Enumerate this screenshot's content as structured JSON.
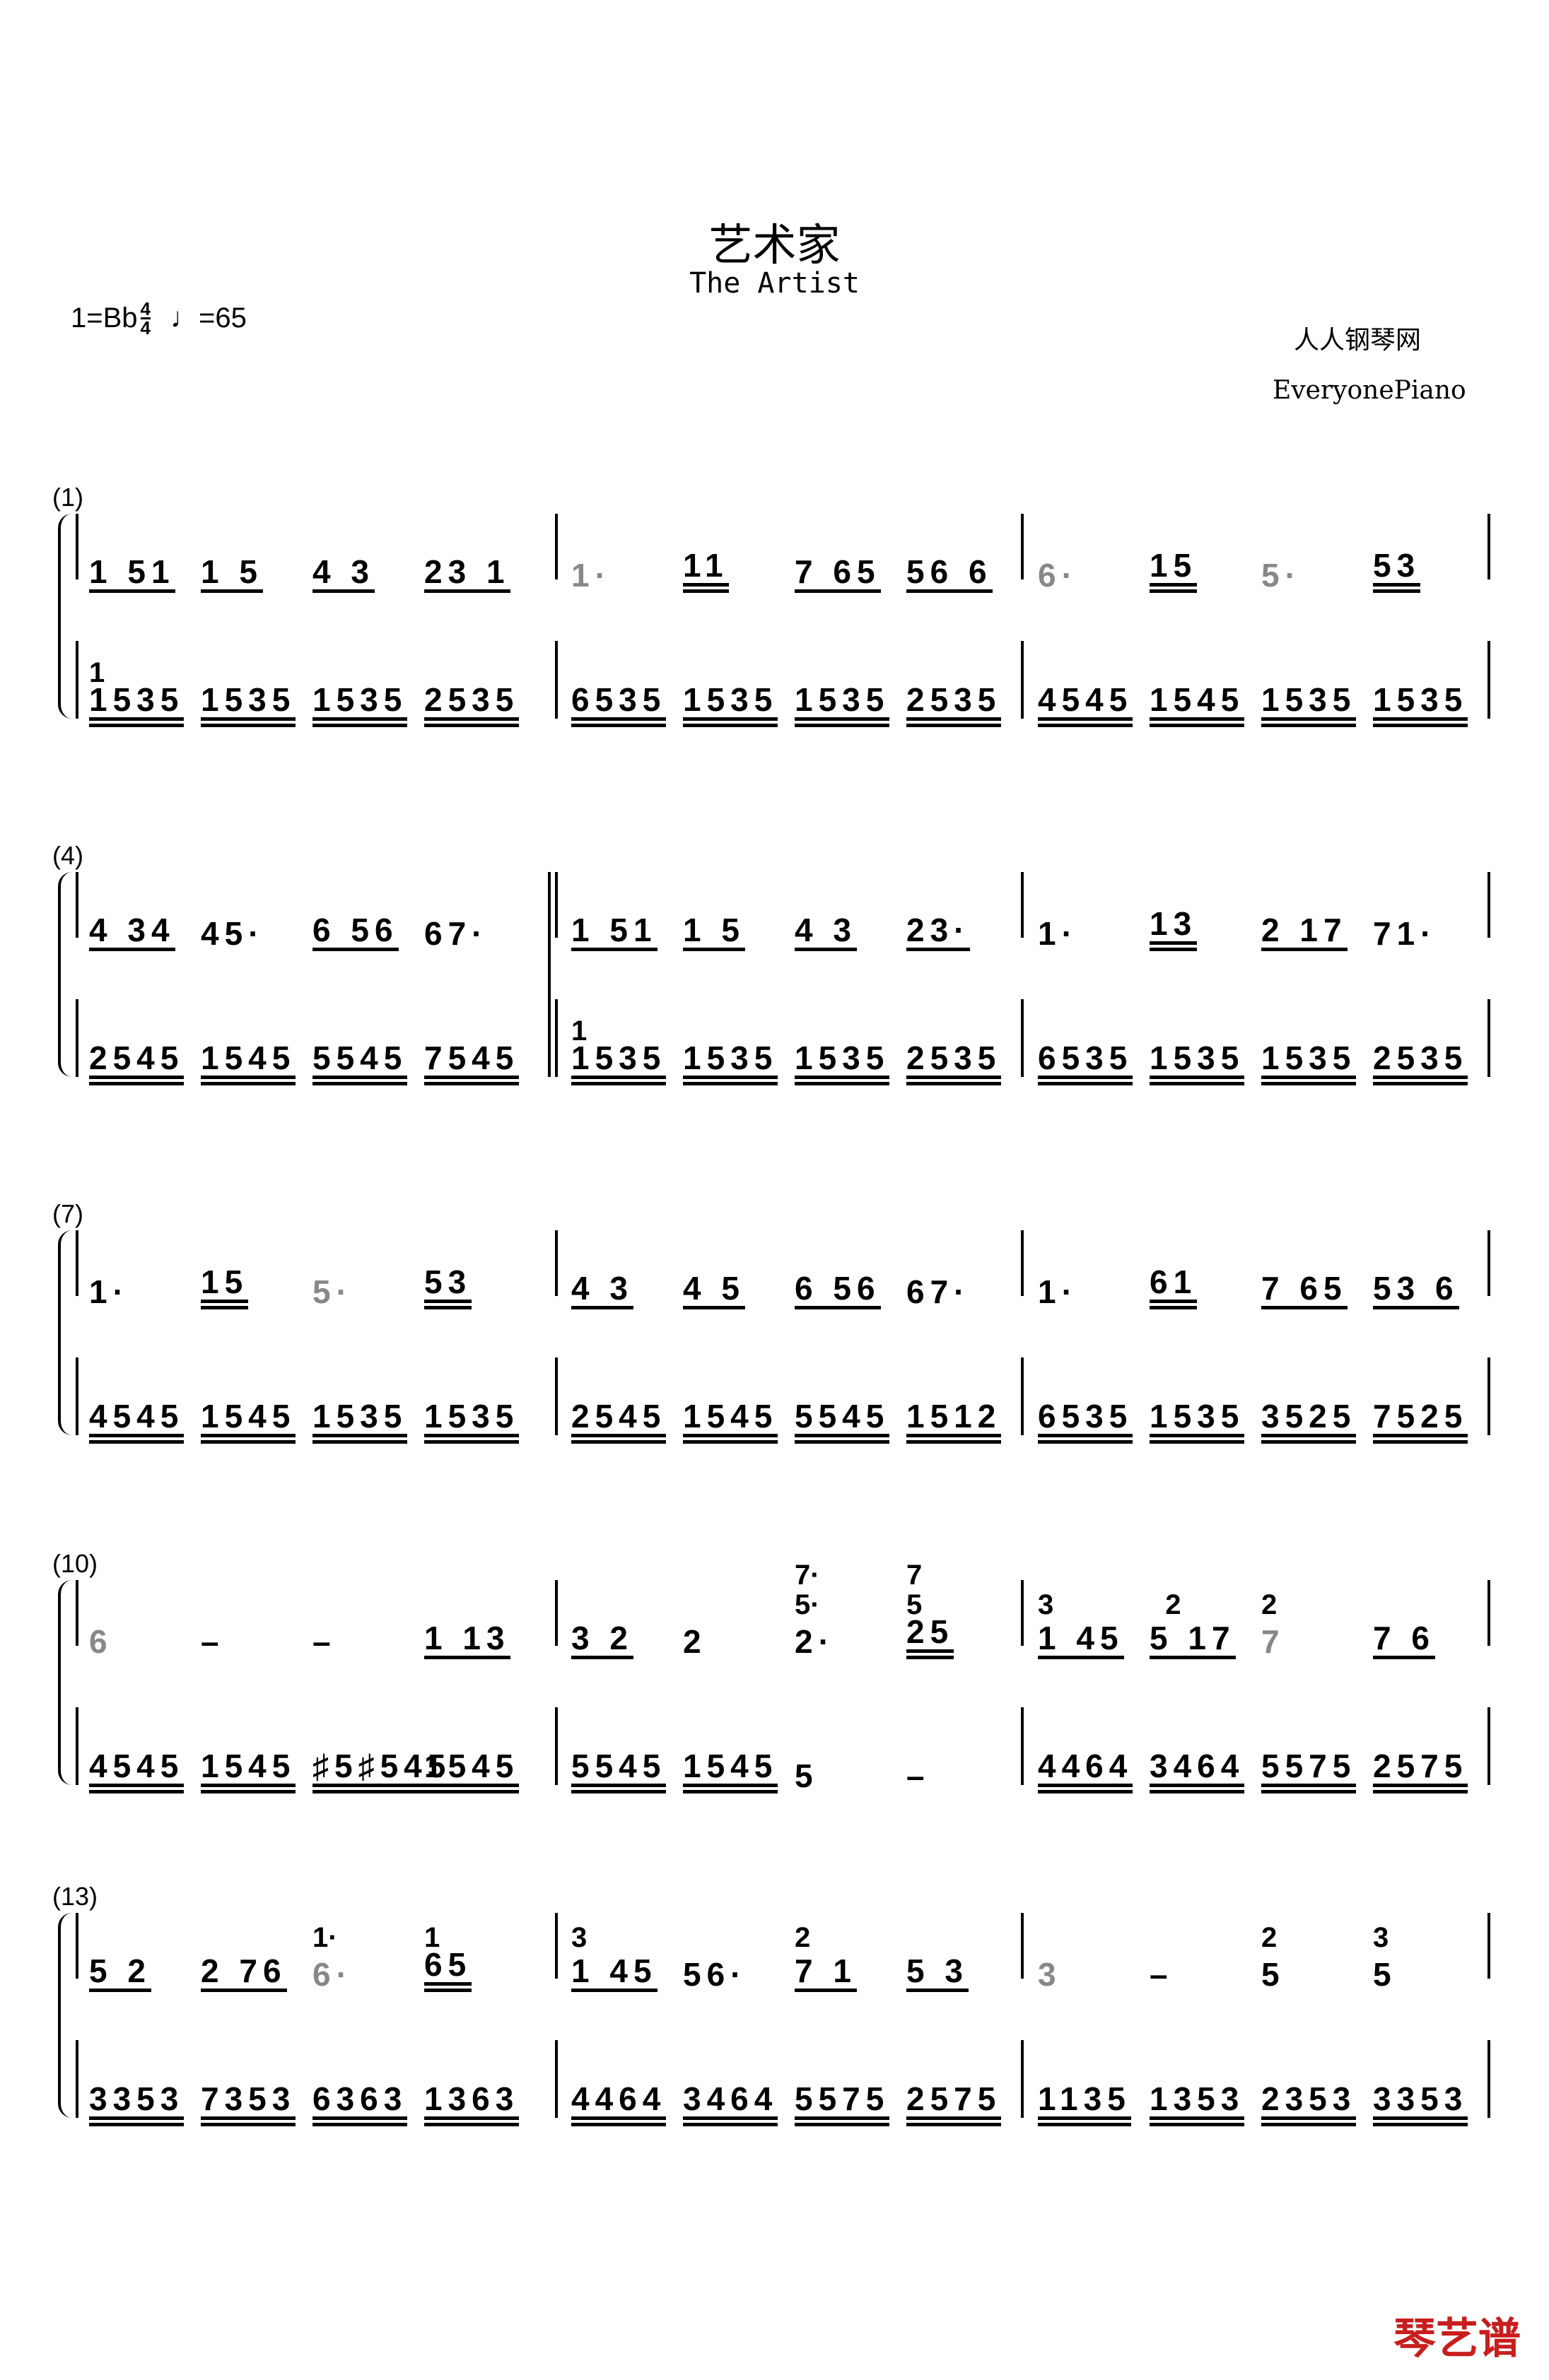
{
  "header": {
    "title": "艺术家",
    "subtitle": "The Artist",
    "key": "1=Bb",
    "time_top": "4",
    "time_bottom": "4",
    "tempo": "♩=65",
    "credit_cn": "人人钢琴网",
    "credit_en": "EveryonePiano"
  },
  "logo": "琴艺谱",
  "logo_color": "#c81e1e",
  "systems": [
    {
      "label": "(1)",
      "measures": [
        {
          "treble": [
            {
              "t": "1 51",
              "u": 1
            },
            {
              "t": "1 5",
              "u": 1
            },
            {
              "t": "4 3",
              "u": 1
            },
            {
              "t": "23 1",
              "u": 1
            }
          ],
          "bass": [
            {
              "t": "1535",
              "above": "1"
            },
            {
              "t": "1535"
            },
            {
              "t": "1535"
            },
            {
              "t": "2535"
            }
          ]
        },
        {
          "treble": [
            {
              "t": "1·",
              "gray": true
            },
            {
              "t": "11",
              "u": 2
            },
            {
              "t": "7 65",
              "u": 1
            },
            {
              "t": "56 6",
              "u": 1
            }
          ],
          "bass": [
            {
              "t": "6535"
            },
            {
              "t": "1535"
            },
            {
              "t": "1535"
            },
            {
              "t": "2535"
            }
          ]
        },
        {
          "treble": [
            {
              "t": "6·",
              "gray": true
            },
            {
              "t": "15",
              "u": 2
            },
            {
              "t": "5·",
              "gray": true
            },
            {
              "t": "53",
              "u": 2
            }
          ],
          "bass": [
            {
              "t": "4545"
            },
            {
              "t": "1545"
            },
            {
              "t": "1535"
            },
            {
              "t": "1535"
            }
          ]
        }
      ]
    },
    {
      "label": "(4)",
      "measures": [
        {
          "treble": [
            {
              "t": "4 34",
              "u": 1
            },
            {
              "t": "45·"
            },
            {
              "t": "6 56",
              "u": 1
            },
            {
              "t": "67·"
            }
          ],
          "bass": [
            {
              "t": "2545"
            },
            {
              "t": "1545"
            },
            {
              "t": "5545"
            },
            {
              "t": "7545"
            }
          ]
        },
        {
          "treble": [
            {
              "t": "1 51",
              "u": 1
            },
            {
              "t": "1 5",
              "u": 1
            },
            {
              "t": "4 3",
              "u": 1
            },
            {
              "t": "23·",
              "u": 1
            }
          ],
          "bass": [
            {
              "t": "1535",
              "above": "1"
            },
            {
              "t": "1535"
            },
            {
              "t": "1535"
            },
            {
              "t": "2535"
            }
          ]
        },
        {
          "treble": [
            {
              "t": "1·"
            },
            {
              "t": "13",
              "u": 2
            },
            {
              "t": "2 17",
              "u": 1
            },
            {
              "t": "71·"
            }
          ],
          "bass": [
            {
              "t": "6535"
            },
            {
              "t": "1535"
            },
            {
              "t": "1535"
            },
            {
              "t": "2535"
            }
          ]
        }
      ]
    },
    {
      "label": "(7)",
      "measures": [
        {
          "treble": [
            {
              "t": "1·"
            },
            {
              "t": "15",
              "u": 2
            },
            {
              "t": "5·",
              "gray": true
            },
            {
              "t": "53",
              "u": 2
            }
          ],
          "bass": [
            {
              "t": "4545"
            },
            {
              "t": "1545"
            },
            {
              "t": "1535"
            },
            {
              "t": "1535"
            }
          ]
        },
        {
          "treble": [
            {
              "t": "4 3",
              "u": 1
            },
            {
              "t": "4 5",
              "u": 1
            },
            {
              "t": "6 56",
              "u": 1
            },
            {
              "t": "67·"
            }
          ],
          "bass": [
            {
              "t": "2545"
            },
            {
              "t": "1545"
            },
            {
              "t": "5545"
            },
            {
              "t": "1512"
            }
          ]
        },
        {
          "treble": [
            {
              "t": "1·"
            },
            {
              "t": "61",
              "u": 2
            },
            {
              "t": "7 65",
              "u": 1
            },
            {
              "t": "53 6",
              "u": 1
            }
          ],
          "bass": [
            {
              "t": "6535"
            },
            {
              "t": "1535"
            },
            {
              "t": "3525"
            },
            {
              "t": "7525"
            }
          ]
        }
      ]
    },
    {
      "label": "(10)",
      "measures": [
        {
          "treble": [
            {
              "t": "6",
              "gray": true
            },
            {
              "t": "–"
            },
            {
              "t": "–"
            },
            {
              "t": "1 13",
              "u": 1
            }
          ],
          "bass": [
            {
              "t": "4545"
            },
            {
              "t": "1545"
            },
            {
              "t": "♯5♯545"
            },
            {
              "t": "1545"
            }
          ]
        },
        {
          "treble": [
            {
              "t": "3 2",
              "u": 1
            },
            {
              "t": "2"
            },
            {
              "t": "2·",
              "above": "7·\n5·"
            },
            {
              "t": "25",
              "u": 2,
              "above": "7\n5"
            }
          ],
          "bass": [
            {
              "t": "5545"
            },
            {
              "t": "1545"
            },
            {
              "t": "5"
            },
            {
              "t": "–"
            }
          ]
        },
        {
          "treble": [
            {
              "t": "1 45",
              "u": 1,
              "above": "3"
            },
            {
              "t": "5 17",
              "u": 1,
              "above": "  2"
            },
            {
              "t": "7",
              "gray": true,
              "above": "2"
            },
            {
              "t": "7 6",
              "u": 1
            }
          ],
          "bass": [
            {
              "t": "4464"
            },
            {
              "t": "3464"
            },
            {
              "t": "5575"
            },
            {
              "t": "2575"
            }
          ]
        }
      ]
    },
    {
      "label": "(13)",
      "measures": [
        {
          "treble": [
            {
              "t": "5 2",
              "u": 1
            },
            {
              "t": "2 76",
              "u": 1
            },
            {
              "t": "6·",
              "gray": true,
              "above": "1·"
            },
            {
              "t": "65",
              "u": 2,
              "above": "1"
            }
          ],
          "bass": [
            {
              "t": "3353"
            },
            {
              "t": "7353"
            },
            {
              "t": "6363"
            },
            {
              "t": "1363"
            }
          ]
        },
        {
          "treble": [
            {
              "t": "1 45",
              "u": 1,
              "above": "3"
            },
            {
              "t": "56·"
            },
            {
              "t": "7 1",
              "u": 1,
              "above": "2"
            },
            {
              "t": "5 3",
              "u": 1
            }
          ],
          "bass": [
            {
              "t": "4464"
            },
            {
              "t": "3464"
            },
            {
              "t": "5575"
            },
            {
              "t": "2575"
            }
          ]
        },
        {
          "treble": [
            {
              "t": "3",
              "gray": true
            },
            {
              "t": "–"
            },
            {
              "t": "5",
              "above": "2"
            },
            {
              "t": "5",
              "above": "3"
            }
          ],
          "bass": [
            {
              "t": "1135"
            },
            {
              "t": "1353"
            },
            {
              "t": "2353"
            },
            {
              "t": "3353"
            }
          ]
        }
      ]
    }
  ]
}
